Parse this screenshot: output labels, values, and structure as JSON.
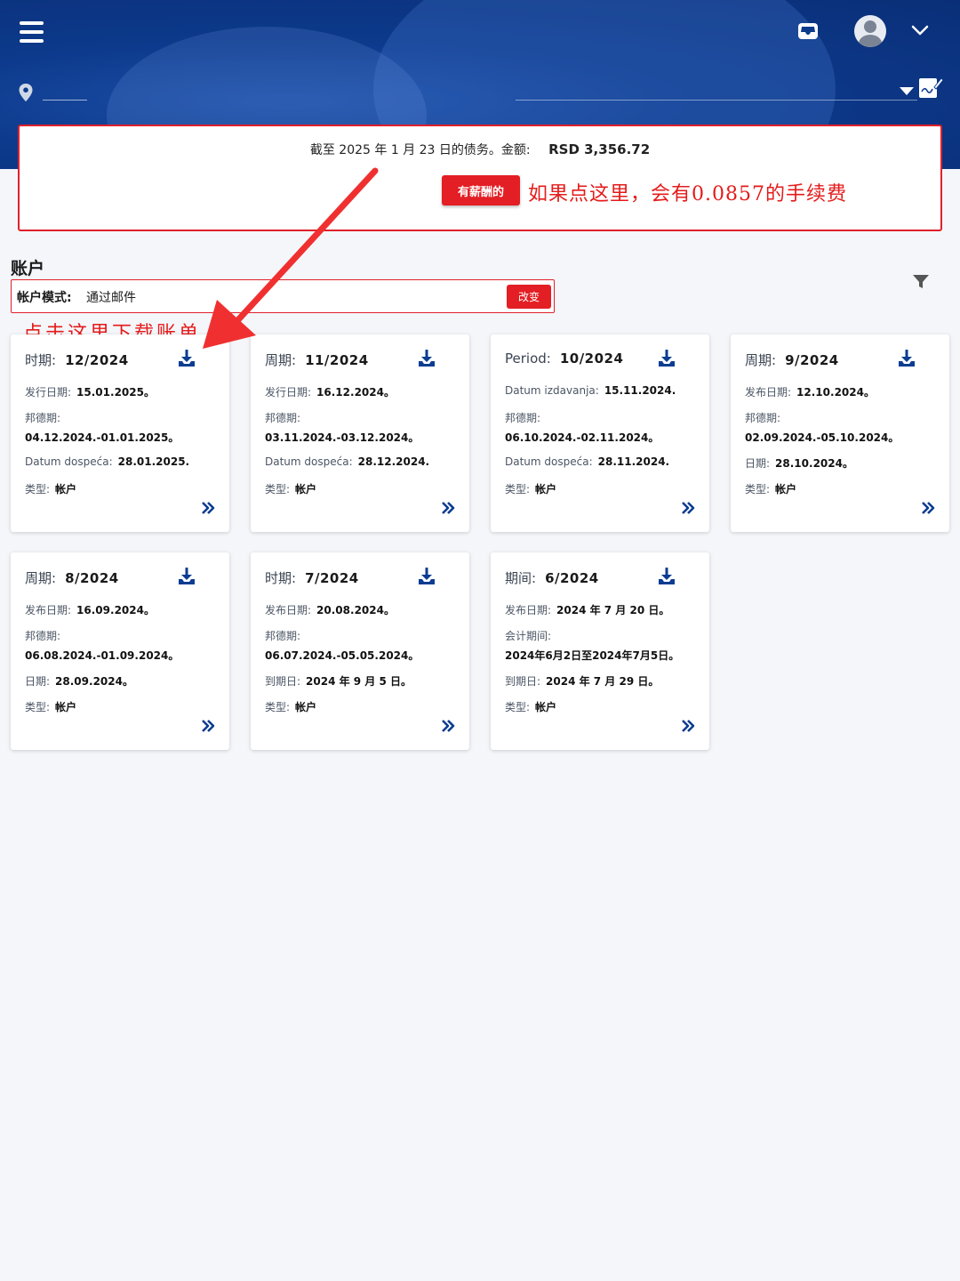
{
  "header": {
    "menu_icon": "hamburger-menu-icon",
    "inbox_icon": "inbox-icon",
    "avatar_icon": "user-avatar-icon",
    "chevron_icon": "chevron-down-icon",
    "location_icon": "map-pin-icon",
    "sign_icon": "document-sign-icon"
  },
  "debt": {
    "text": "截至 2025 年 1 月 23 日的债务。金额:",
    "amount": "RSD 3,356.72",
    "pay_label": "有薪酬的"
  },
  "annotations": {
    "fee_note": "如果点这里，会有0.0857的手续费",
    "download_note": "点击这里下载账单"
  },
  "accounts": {
    "title": "账户",
    "mode_label": "帐户模式:",
    "mode_value": "通过邮件",
    "change_label": "改变",
    "filter_icon": "filter-icon"
  },
  "cards": [
    {
      "period_label": "时期:",
      "period": "12/2024",
      "issue_label": "发行日期:",
      "issue": "15.01.2025。",
      "range_label": "邦德期:",
      "range": "04.12.2024.-01.01.2025。",
      "due_label": "Datum dospeća:",
      "due": "28.01.2025.",
      "type_label": "类型:",
      "type": "帐户"
    },
    {
      "period_label": "周期:",
      "period": "11/2024",
      "issue_label": "发行日期:",
      "issue": "16.12.2024。",
      "range_label": "邦德期:",
      "range": "03.11.2024.-03.12.2024。",
      "due_label": "Datum dospeća:",
      "due": "28.12.2024.",
      "type_label": "类型:",
      "type": "帐户"
    },
    {
      "period_label": "Period:",
      "period": "10/2024",
      "issue_label": "Datum izdavanja:",
      "issue": "15.11.2024.",
      "range_label": "邦德期:",
      "range": "06.10.2024.-02.11.2024。",
      "due_label": "Datum dospeća:",
      "due": "28.11.2024.",
      "type_label": "类型:",
      "type": "帐户"
    },
    {
      "period_label": "周期:",
      "period": "9/2024",
      "issue_label": "发布日期:",
      "issue": "12.10.2024。",
      "range_label": "邦德期:",
      "range": "02.09.2024.-05.10.2024。",
      "due_label": "日期:",
      "due": "28.10.2024。",
      "type_label": "类型:",
      "type": "帐户"
    },
    {
      "period_label": "周期:",
      "period": "8/2024",
      "issue_label": "发布日期:",
      "issue": "16.09.2024。",
      "range_label": "邦德期:",
      "range": "06.08.2024.-01.09.2024。",
      "due_label": "日期:",
      "due": "28.09.2024。",
      "type_label": "类型:",
      "type": "帐户"
    },
    {
      "period_label": "时期:",
      "period": "7/2024",
      "issue_label": "发布日期:",
      "issue": "20.08.2024。",
      "range_label": "邦德期:",
      "range": "06.07.2024.-05.05.2024。",
      "due_label": "到期日:",
      "due": "2024 年 9 月 5 日。",
      "type_label": "类型:",
      "type": "帐户"
    },
    {
      "period_label": "期间:",
      "period": "6/2024",
      "issue_label": "发布日期:",
      "issue": "2024 年 7 月 20 日。",
      "range_label": "会计期间:",
      "range": "2024年6月2日至2024年7月5日。",
      "due_label": "到期日:",
      "due": "2024 年 7 月 29 日。",
      "type_label": "类型:",
      "type": "帐户"
    }
  ],
  "colors": {
    "brand_blue": "#0d3a8c",
    "accent_red": "#e31e24",
    "icon_blue": "#0b3d91"
  }
}
